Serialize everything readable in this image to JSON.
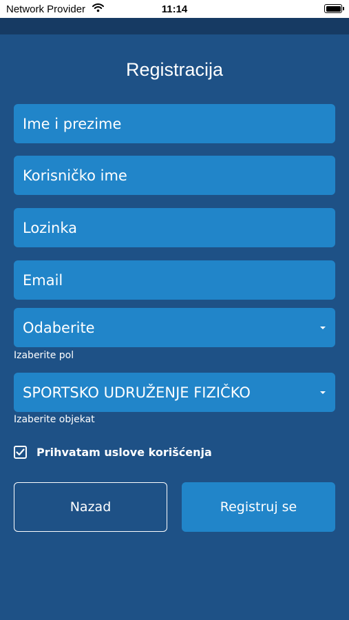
{
  "status_bar": {
    "provider": "Network Provider",
    "time": "11:14",
    "icons": [
      "wifi-icon",
      "battery-icon"
    ]
  },
  "page": {
    "title": "Registracija"
  },
  "form": {
    "full_name_placeholder": "Ime i prezime",
    "username_placeholder": "Korisničko ime",
    "password_placeholder": "Lozinka",
    "email_placeholder": "Email",
    "gender_select": {
      "value": "Odaberite",
      "hint": "Izaberite pol"
    },
    "facility_select": {
      "value": "SPORTSKO UDRUŽENJE FIZIČKO",
      "hint": "Izaberite objekat"
    },
    "terms": {
      "label": "Prihvatam uslove korišćenja",
      "checked": true
    }
  },
  "buttons": {
    "back": "Nazad",
    "register": "Registruj se"
  },
  "colors": {
    "background": "#1e5186",
    "field": "#2185c9",
    "top_band": "#163a63"
  }
}
